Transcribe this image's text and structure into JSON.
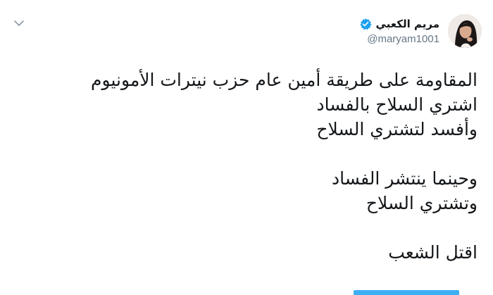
{
  "user": {
    "display_name": "مريم الكعبي",
    "handle": "@maryam1001",
    "verified": true
  },
  "tweet": {
    "lines": [
      "المقاومة على طريقة أمين عام حزب نيترات الأمونيوم",
      "اشتري السلاح بالفساد",
      "وأفسد لتشتري السلاح",
      "",
      "وحينما ينتشر الفساد",
      "وتشتري السلاح",
      "",
      "اقتل الشعب"
    ]
  },
  "colors": {
    "text": "#14171a",
    "secondary": "#657786",
    "verified": "#1da1f2",
    "link": "#1da1f2"
  },
  "icons": {
    "menu": "chevron-down-icon",
    "verified": "verified-badge-icon"
  }
}
